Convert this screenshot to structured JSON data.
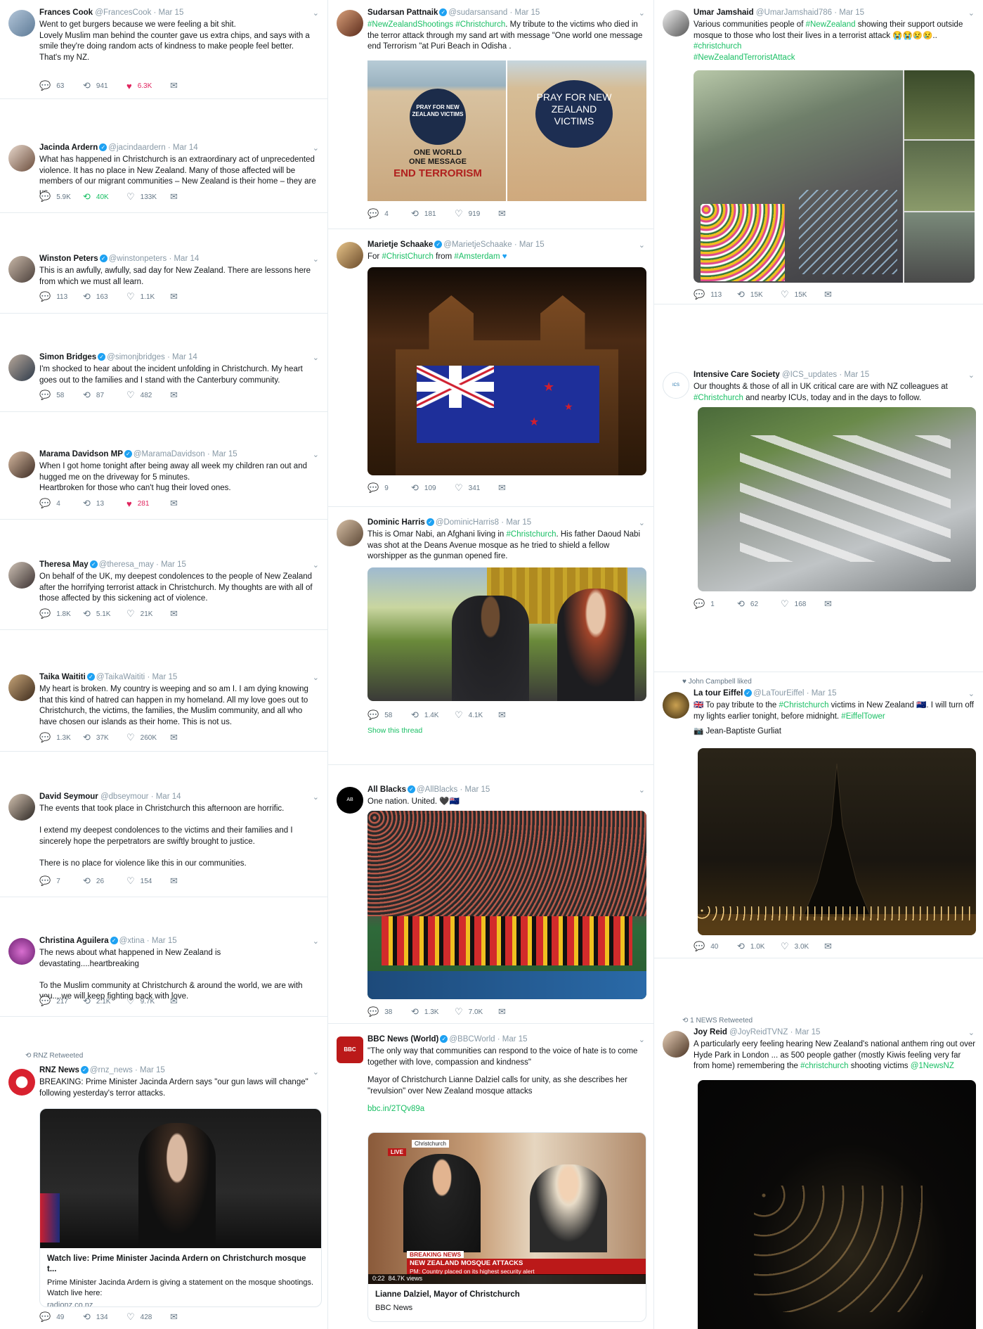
{
  "tweets": {
    "frances": {
      "name": "Frances Cook",
      "handle": "@FrancesCook",
      "date": "· Mar 15",
      "text": "Went to get burgers because we were feeling a bit shit.\nLovely Muslim man behind the counter gave us extra chips, and says with a smile they're doing random acts of kindness to make people feel better.\nThat's my NZ.",
      "replies": "63",
      "retweets": "941",
      "likes": "6.3K"
    },
    "jacinda": {
      "name": "Jacinda Ardern",
      "handle": "@jacindaardern",
      "date": "· Mar 14",
      "text": "What has happened in Christchurch is an extraordinary act of unprecedented violence. It has no place in New Zealand. Many of those affected will be members of our migrant communities – New Zealand is their home – they are us.",
      "replies": "5.9K",
      "retweets": "40K",
      "likes": "133K"
    },
    "winston": {
      "name": "Winston Peters",
      "handle": "@winstonpeters",
      "date": "· Mar 14",
      "text": "This is an awfully, awfully, sad day for New Zealand. There are lessons here from which we must all learn.",
      "replies": "113",
      "retweets": "163",
      "likes": "1.1K"
    },
    "simon": {
      "name": "Simon Bridges",
      "handle": "@simonjbridges",
      "date": "· Mar 14",
      "text": "I'm shocked to hear about the incident unfolding in Christchurch. My heart goes out to the families and I stand with the Canterbury community.",
      "replies": "58",
      "retweets": "87",
      "likes": "482"
    },
    "marama": {
      "name": "Marama Davidson MP",
      "handle": "@MaramaDavidson",
      "date": "· Mar 15",
      "text": "When I got home tonight after being away all week my children ran out and hugged me on the driveway for 5 minutes.\nHeartbroken for those who can't hug their loved ones.",
      "replies": "4",
      "retweets": "13",
      "likes": "281"
    },
    "theresa": {
      "name": "Theresa May",
      "handle": "@theresa_may",
      "date": "· Mar 15",
      "text": "On behalf of the UK, my deepest condolences to the people of New Zealand after the horrifying terrorist attack in Christchurch. My thoughts are with all of those affected by this sickening act of violence.",
      "replies": "1.8K",
      "retweets": "5.1K",
      "likes": "21K"
    },
    "taika": {
      "name": "Taika Waititi",
      "handle": "@TaikaWaititi",
      "date": "· Mar 15",
      "text": "My heart is broken. My country is weeping and so am I. I am dying knowing that this kind of hatred can happen in my homeland. All my love goes out to Christchurch, the victims, the families, the Muslim community, and all who have chosen our islands as their home. This is not us.",
      "replies": "1.3K",
      "retweets": "37K",
      "likes": "260K"
    },
    "david": {
      "name": "David Seymour",
      "handle": "@dbseymour",
      "date": "· Mar 14",
      "text": "The events that took place in Christchurch this afternoon are horrific.\n\nI extend my deepest condolences to the victims and their families and I sincerely hope the perpetrators are swiftly brought to justice.\n\nThere is no place for violence like this in our communities.",
      "replies": "7",
      "retweets": "26",
      "likes": "154"
    },
    "christina": {
      "name": "Christina Aguilera",
      "handle": "@xtina",
      "date": "· Mar 15",
      "text": "The news about what happened in New Zealand is devastating....heartbreaking\n\nTo the Muslim community at Christchurch & around the world, we are with you....we will keep fighting back with love.",
      "replies": "217",
      "retweets": "2.1K",
      "likes": "9.7K"
    },
    "rnz": {
      "context": "RNZ Retweeted",
      "name": "RNZ News",
      "handle": "@rnz_news",
      "date": "· Mar 15",
      "text": "BREAKING: Prime Minister Jacinda Ardern says \"our gun laws will change\" following yesterday's terror attacks.",
      "card_title": "Watch live: Prime Minister Jacinda Ardern on Christchurch mosque t...",
      "card_desc": "Prime Minister Jacinda Ardern is giving a statement on the mosque shootings. Watch live here:",
      "card_domain": "radionz.co.nz",
      "replies": "49",
      "retweets": "134",
      "likes": "428"
    },
    "sudarsan": {
      "name": "Sudarsan Pattnaik",
      "handle": "@sudarsansand",
      "date": "· Mar 15",
      "hashtags": "#NewZealandShootings #Christchurch",
      "text": ". My tribute to the victims who died in the terror attack through my sand art with message \"One world one message end Terrorism \"at Puri Beach in Odisha .",
      "sand_left": "PRAY FOR NEW ZEALAND VICTIMS",
      "sand_right": "PRAY FOR NEW ZEALAND VICTIMS",
      "sand_msg1": "ONE WORLD",
      "sand_msg2": "ONE MESSAGE",
      "sand_msg3": "END TERRORISM",
      "replies": "4",
      "retweets": "181",
      "likes": "919"
    },
    "marietje": {
      "name": "Marietje Schaake",
      "handle": "@MarietjeSchaake",
      "date": "· Mar 15",
      "prefix": "For ",
      "tag1": "#ChristChurch",
      "mid": " from ",
      "tag2": "#Amsterdam",
      "replies": "9",
      "retweets": "109",
      "likes": "341"
    },
    "dominic": {
      "name": "Dominic Harris",
      "handle": "@DominicHarris8",
      "date": "· Mar 15",
      "text1": "This is Omar Nabi, an Afghani living in ",
      "tag": "#Christchurch",
      "text2": ". His father Daoud Nabi was shot at the Deans Avenue mosque as he tried to shield a fellow worshipper as the gunman opened fire.",
      "replies": "58",
      "retweets": "1.4K",
      "likes": "4.1K",
      "thread": "Show this thread"
    },
    "allblacks": {
      "name": "All Blacks",
      "handle": "@AllBlacks",
      "date": "· Mar 15",
      "text": "One nation. United. 🖤🇳🇿",
      "replies": "38",
      "retweets": "1.3K",
      "likes": "7.0K"
    },
    "bbc": {
      "name": "BBC News (World)",
      "handle": "@BBCWorld",
      "date": "· Mar 15",
      "text1": "\"The only way that communities can respond to the voice of hate is to come together with love, compassion and kindness\"",
      "text2": "Mayor of Christchurch Lianne Dalziel calls for unity, as she describes her \"revulsion\" over New Zealand mosque attacks",
      "link": "bbc.in/2TQv89a",
      "breaking": "BREAKING NEWS",
      "headline": "NEW ZEALAND MOSQUE ATTACKS",
      "sub": "PM: Country placed on its highest security alert",
      "time": "0:22",
      "views": "84.7K views",
      "card_title": "Lianne Dalziel, Mayor of Christchurch",
      "card_src": "BBC News",
      "live": "LIVE",
      "place": "Christchurch"
    },
    "umar": {
      "name": "Umar Jamshaid",
      "handle": "@UmarJamshaid786",
      "date": "· Mar 15",
      "text1": "Various communities people of ",
      "tag1": "#NewZealand",
      "text2": " showing their support outside mosque to those who lost their lives in a terrorist attack 😭😭😢😢..",
      "tag2": "#christchurch",
      "tag3": "#NewZealandTerroristAttack",
      "replies": "113",
      "retweets": "15K",
      "likes": "15K"
    },
    "ics": {
      "name": "Intensive Care Society",
      "handle": "@ICS_updates",
      "date": "· Mar 15",
      "text1": "Our thoughts & those of all in UK critical care are with NZ colleagues at ",
      "tag": "#Christchurch",
      "text2": " and nearby ICUs, today and in the days to follow.",
      "replies": "1",
      "retweets": "62",
      "likes": "168"
    },
    "eiffel": {
      "context": "John Campbell liked",
      "name": "La tour Eiffel",
      "handle": "@LaTourEiffel",
      "date": "· Mar 15",
      "text1": "🇬🇧 To pay tribute to the ",
      "tag1": "#Christchurch",
      "text2": " victims in New Zealand 🇳🇿. I will turn off my lights earlier tonight, before midnight. ",
      "tag2": "#EiffelTower",
      "credit": "📷 Jean-Baptiste Gurliat",
      "replies": "40",
      "retweets": "1.0K",
      "likes": "3.0K"
    },
    "joy": {
      "context": "1 NEWS Retweeted",
      "name": "Joy Reid",
      "handle": "@JoyReidTVNZ",
      "date": "· Mar 15",
      "text1": "A particularly eery feeling hearing New Zealand's national anthem ring out over Hyde Park in London ... as 500 people gather (mostly Kiwis feeling very far from home) remembering the ",
      "tag": "#christchurch",
      "text2": " shooting victims ",
      "mention": "@1NewsNZ"
    }
  },
  "icons": {
    "reply": "💬",
    "retweet": "⟲",
    "like": "♡",
    "liked": "♥",
    "dm": "✉",
    "caret": "⌄",
    "verified": "✓"
  },
  "colors": {
    "hashtag": "#19bf64",
    "link": "#1da1f2",
    "like": "#e0245e",
    "retweet": "#17bf63"
  }
}
